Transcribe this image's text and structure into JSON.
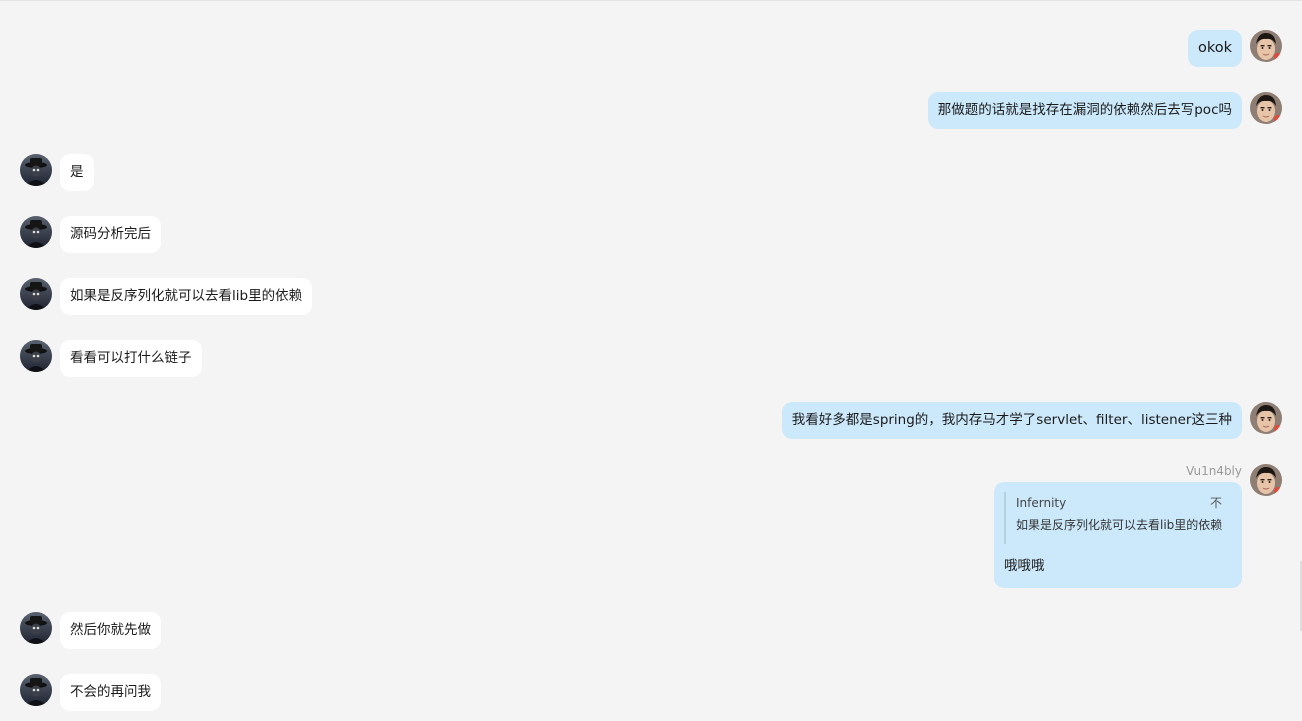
{
  "conversation": {
    "messages": [
      {
        "side": "right",
        "text": "okok"
      },
      {
        "side": "right",
        "text": "那做题的话就是找存在漏洞的依赖然后去写poc吗"
      },
      {
        "side": "left",
        "text": "是"
      },
      {
        "side": "left",
        "text": "源码分析完后"
      },
      {
        "side": "left",
        "text": "如果是反序列化就可以去看lib里的依赖"
      },
      {
        "side": "left",
        "text": "看看可以打什么链子"
      },
      {
        "side": "right",
        "text": "我看好多都是spring的，我内存马才学了servlet、filter、listener这三种"
      },
      {
        "side": "right",
        "sender": "Vu1n4bly",
        "quote": {
          "author": "Infernity",
          "close_label": "不",
          "text": "如果是反序列化就可以去看lib里的依赖"
        },
        "text": "哦哦哦"
      },
      {
        "side": "left",
        "text": "然后你就先做"
      },
      {
        "side": "left",
        "text": "不会的再问我"
      }
    ]
  },
  "avatars": {
    "self_icon": "user-photo-avatar",
    "peer_icon": "hat-figure-avatar"
  },
  "colors": {
    "background": "#f4f4f4",
    "self_bubble": "#cce9fb",
    "peer_bubble": "#ffffff"
  }
}
